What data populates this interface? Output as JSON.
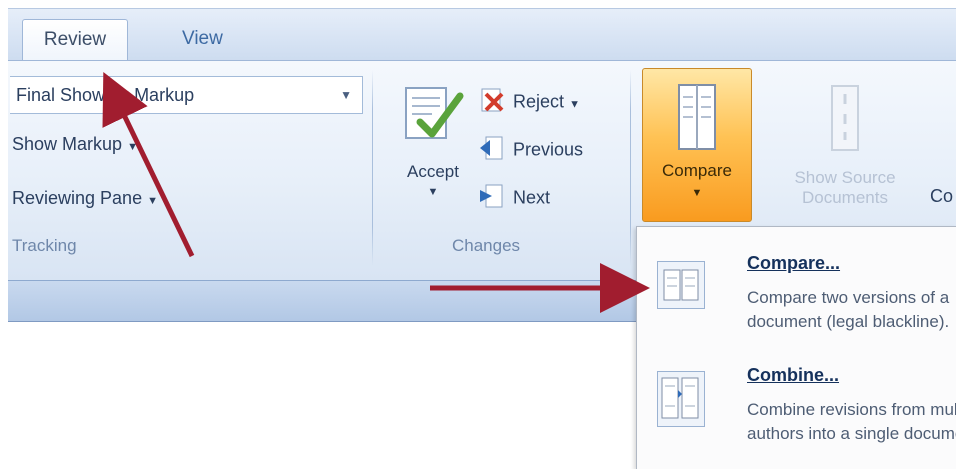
{
  "tabs": {
    "review": "Review",
    "view": "View"
  },
  "tracking": {
    "display_dropdown": "Final Showing Markup",
    "show_markup": "Show Markup",
    "reviewing_pane": "Reviewing Pane",
    "group_label": "Tracking"
  },
  "changes": {
    "accept": "Accept",
    "reject": "Reject",
    "previous": "Previous",
    "next": "Next",
    "group_label": "Changes"
  },
  "compare_group": {
    "compare": "Compare",
    "show_source": "Show Source Documents",
    "group_label_partial": "Co"
  },
  "compare_menu": {
    "items": [
      {
        "title": "Compare...",
        "desc_line1": "Compare two versions of a",
        "desc_line2": "document (legal blackline)."
      },
      {
        "title": "Combine...",
        "desc_line1": "Combine revisions from multiple",
        "desc_line2": "authors into a single document."
      }
    ]
  },
  "colors": {
    "accent_orange": "#ffc254",
    "ribbon_blue": "#dbe7f6",
    "arrow_red": "#a11d2f"
  }
}
